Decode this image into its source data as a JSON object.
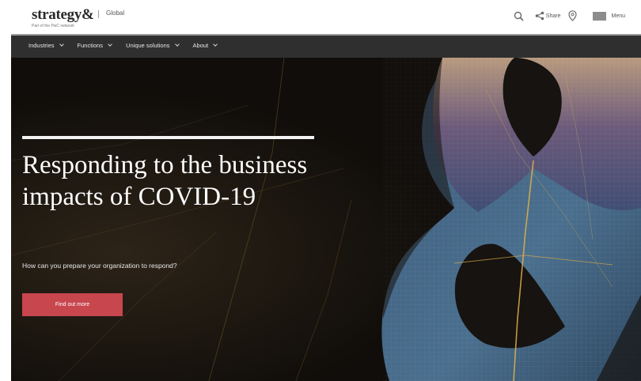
{
  "header": {
    "logo_text": "strategy&",
    "logo_tagline": "Part of the PwC network",
    "region": "Global",
    "share_label": "Share",
    "menu_label": "Menu"
  },
  "nav": {
    "items": [
      {
        "label": "Industries"
      },
      {
        "label": "Functions"
      },
      {
        "label": "Unique solutions"
      },
      {
        "label": "About"
      }
    ]
  },
  "hero": {
    "title": "Responding to the business impacts of COVID-19",
    "subtitle": "How can you prepare your organization to respond?",
    "cta_label": "Find out more"
  },
  "icons": {
    "search": "search-icon",
    "share": "share-icon",
    "location": "location-pin-icon",
    "menu": "hamburger-menu-icon"
  },
  "colors": {
    "nav_background": "#2f2f2f",
    "cta_background": "#c8464e",
    "hero_text": "#ffffff"
  }
}
